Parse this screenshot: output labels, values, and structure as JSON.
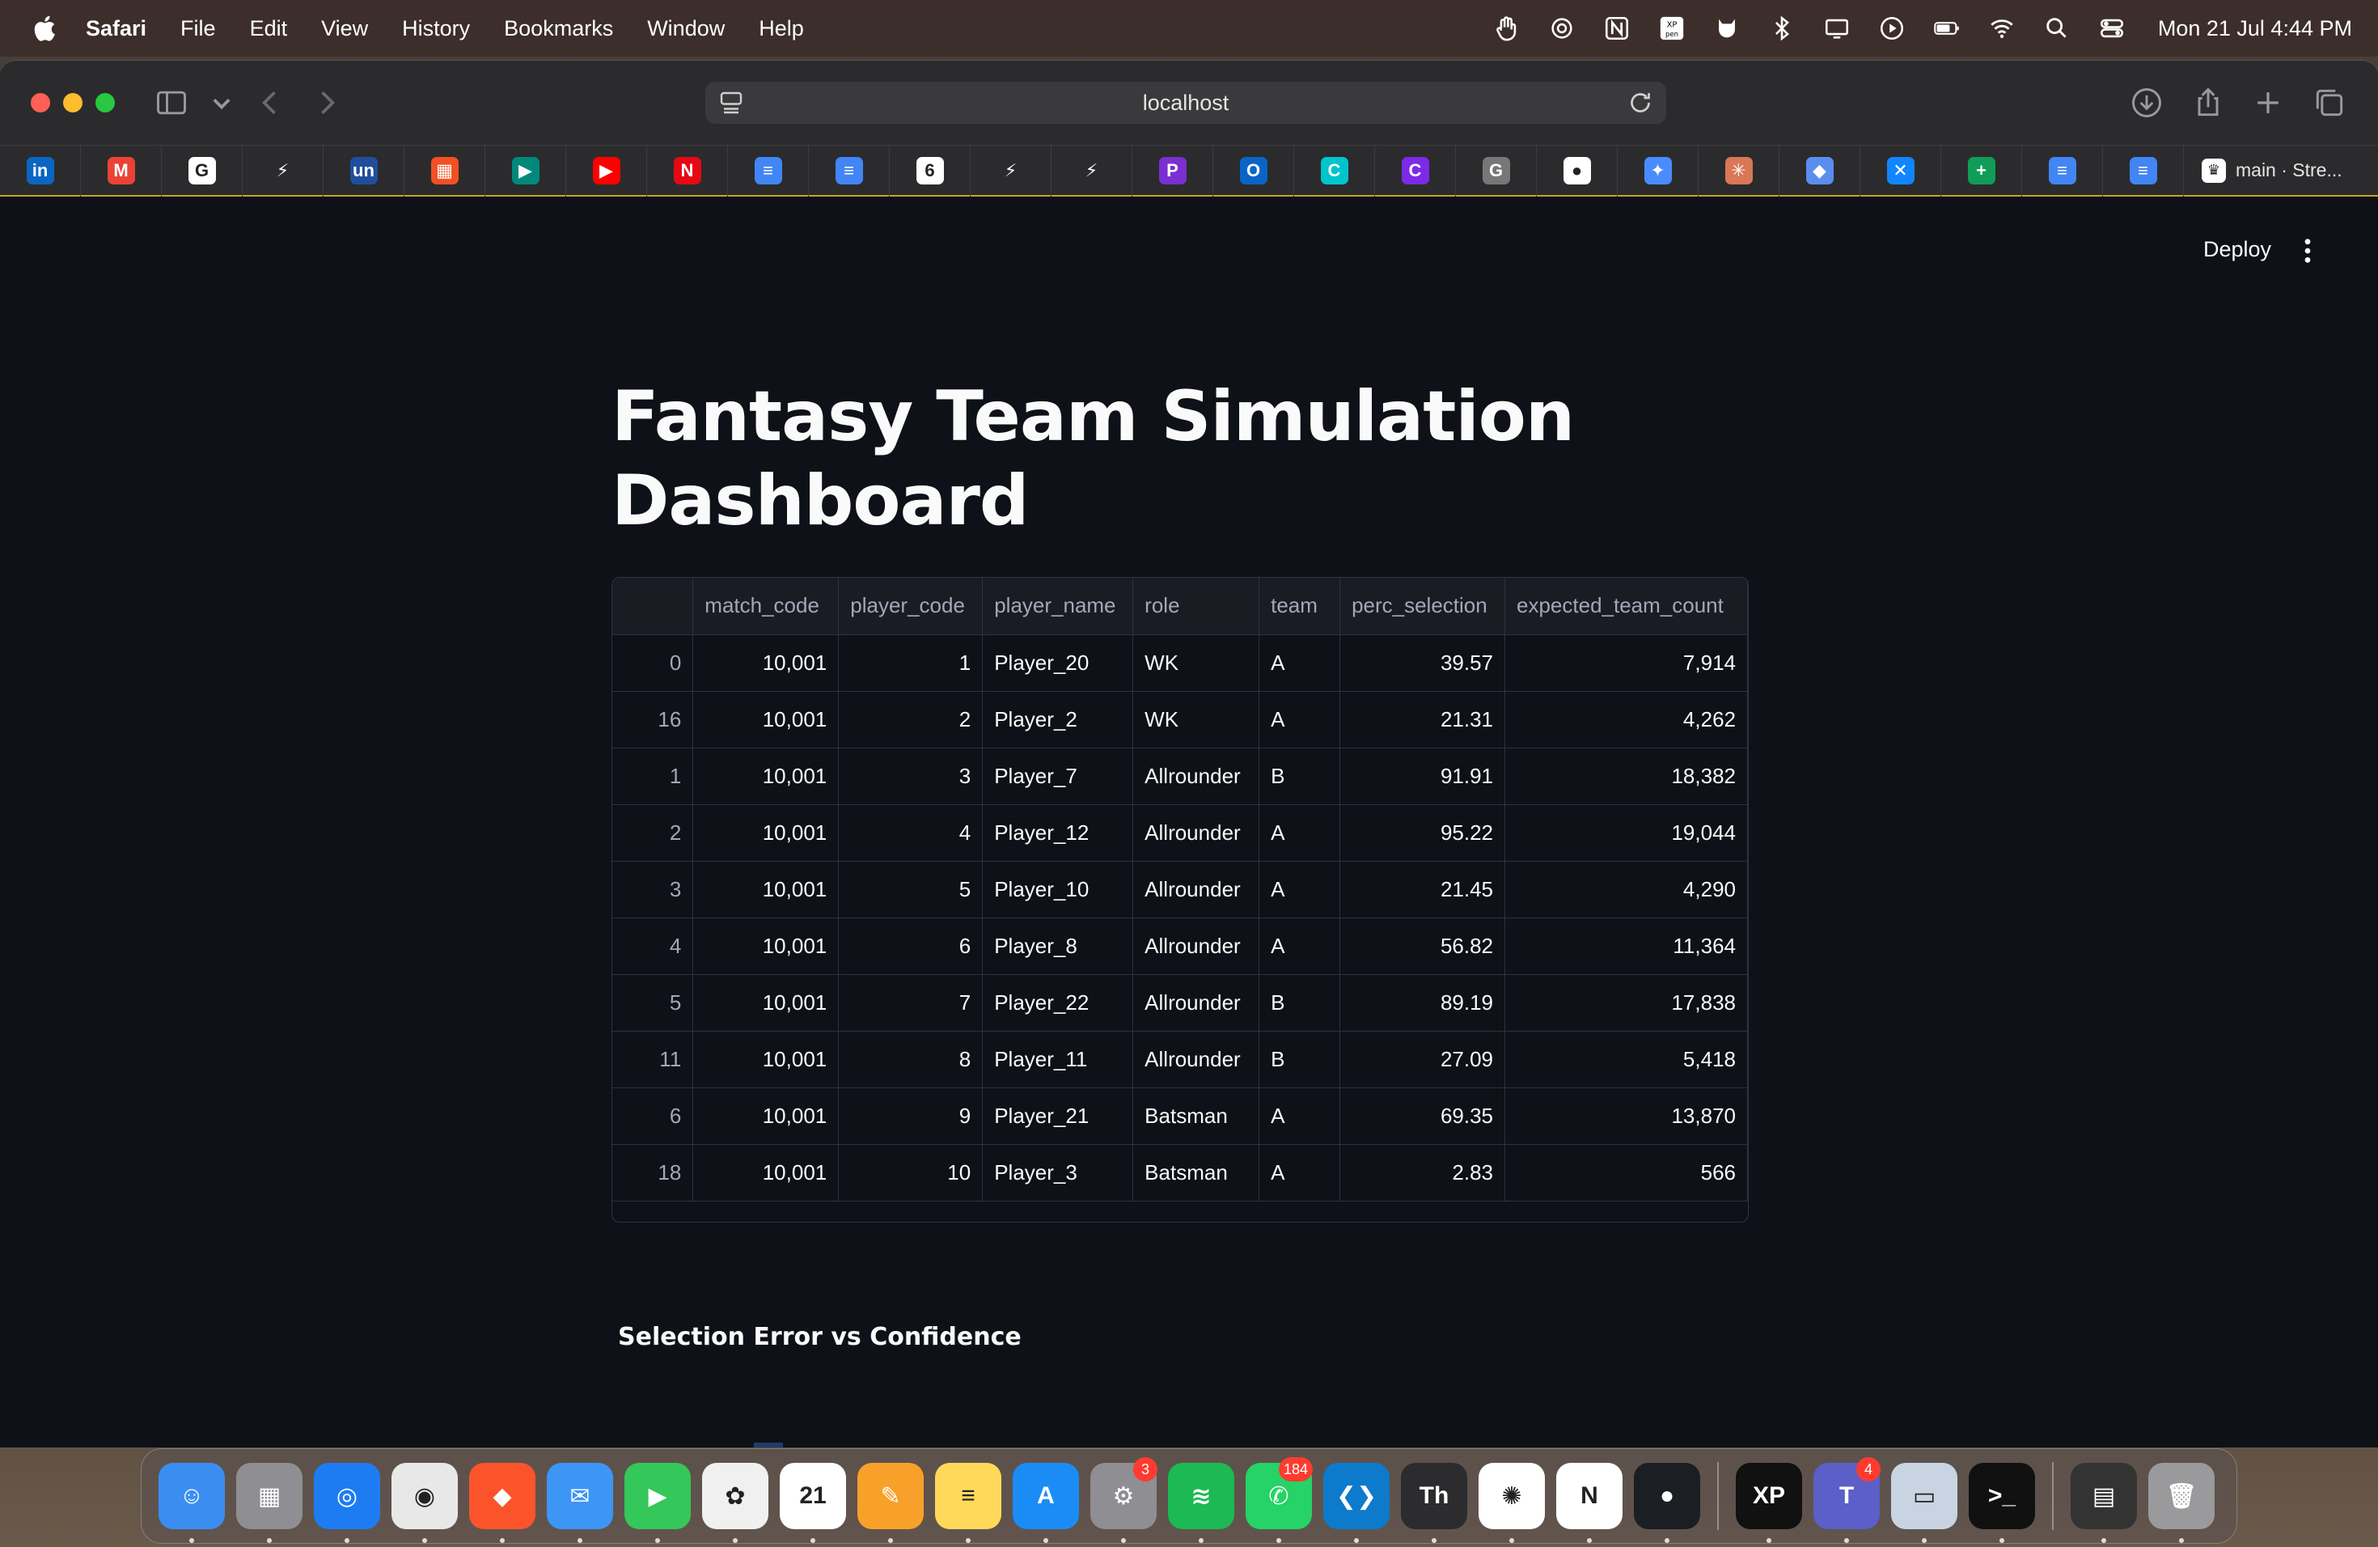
{
  "menubar": {
    "app_name": "Safari",
    "items": [
      "File",
      "Edit",
      "View",
      "History",
      "Bookmarks",
      "Window",
      "Help"
    ],
    "clock": "Mon 21 Jul  4:44 PM"
  },
  "browser": {
    "url": "localhost",
    "active_tab_label": "main · Stre...",
    "favorites": [
      {
        "icon": "linkedin-icon",
        "glyph": "in",
        "color": "#0a66c2"
      },
      {
        "icon": "gmail-icon",
        "glyph": "M",
        "color": "#ea4335"
      },
      {
        "icon": "google-icon",
        "glyph": "G",
        "color": "#ffffff"
      },
      {
        "icon": "bolt-icon",
        "glyph": "⚡",
        "color": "#2b2b2d"
      },
      {
        "icon": "unstop-icon",
        "glyph": "un",
        "color": "#1f4e9c"
      },
      {
        "icon": "microsoft-icon",
        "glyph": "▦",
        "color": "#f25022"
      },
      {
        "icon": "meet-icon",
        "glyph": "▶",
        "color": "#00897b"
      },
      {
        "icon": "youtube-icon",
        "glyph": "▶",
        "color": "#ff0000"
      },
      {
        "icon": "netflix-icon",
        "glyph": "N",
        "color": "#e50914"
      },
      {
        "icon": "docs-icon",
        "glyph": "≡",
        "color": "#4285f4"
      },
      {
        "icon": "docs-icon-2",
        "glyph": "≡",
        "color": "#4285f4"
      },
      {
        "icon": "loop-icon",
        "glyph": "6",
        "color": "#ffffff"
      },
      {
        "icon": "bolt-icon-2",
        "glyph": "⚡",
        "color": "#2b2b2d"
      },
      {
        "icon": "bolt-icon-3",
        "glyph": "⚡",
        "color": "#2b2b2d"
      },
      {
        "icon": "pixel-icon",
        "glyph": "P",
        "color": "#7b2fd1"
      },
      {
        "icon": "outlook-icon",
        "glyph": "O",
        "color": "#0a64c8"
      },
      {
        "icon": "canva-icon",
        "glyph": "C",
        "color": "#00c4cc"
      },
      {
        "icon": "canva-icon-2",
        "glyph": "C",
        "color": "#7d2ae8"
      },
      {
        "icon": "grammarly-icon",
        "glyph": "G",
        "color": "#777777"
      },
      {
        "icon": "github-icon",
        "glyph": "●",
        "color": "#ffffff"
      },
      {
        "icon": "gemini-icon",
        "glyph": "✦",
        "color": "#4a8cff"
      },
      {
        "icon": "claude-icon",
        "glyph": "✳",
        "color": "#d97757"
      },
      {
        "icon": "copilot-icon",
        "glyph": "◆",
        "color": "#5b8def"
      },
      {
        "icon": "bluesky-icon",
        "glyph": "✕",
        "color": "#1185fe"
      },
      {
        "icon": "sheets-icon",
        "glyph": "+",
        "color": "#0f9d58"
      },
      {
        "icon": "docs-icon-3",
        "glyph": "≡",
        "color": "#4285f4"
      },
      {
        "icon": "docs-icon-4",
        "glyph": "≡",
        "color": "#4285f4"
      }
    ]
  },
  "app": {
    "deploy_label": "Deploy",
    "title_line1": "Fantasy Team Simulation",
    "title_line2": "Dashboard",
    "section_title": "Selection Error vs Confidence"
  },
  "table": {
    "columns": [
      "",
      "match_code",
      "player_code",
      "player_name",
      "role",
      "team",
      "perc_selection",
      "expected_team_count"
    ],
    "rows": [
      [
        "0",
        "10,001",
        "1",
        "Player_20",
        "WK",
        "A",
        "39.57",
        "7,914"
      ],
      [
        "16",
        "10,001",
        "2",
        "Player_2",
        "WK",
        "A",
        "21.31",
        "4,262"
      ],
      [
        "1",
        "10,001",
        "3",
        "Player_7",
        "Allrounder",
        "B",
        "91.91",
        "18,382"
      ],
      [
        "2",
        "10,001",
        "4",
        "Player_12",
        "Allrounder",
        "A",
        "95.22",
        "19,044"
      ],
      [
        "3",
        "10,001",
        "5",
        "Player_10",
        "Allrounder",
        "A",
        "21.45",
        "4,290"
      ],
      [
        "4",
        "10,001",
        "6",
        "Player_8",
        "Allrounder",
        "A",
        "56.82",
        "11,364"
      ],
      [
        "5",
        "10,001",
        "7",
        "Player_22",
        "Allrounder",
        "B",
        "89.19",
        "17,838"
      ],
      [
        "11",
        "10,001",
        "8",
        "Player_11",
        "Allrounder",
        "B",
        "27.09",
        "5,418"
      ],
      [
        "6",
        "10,001",
        "9",
        "Player_21",
        "Batsman",
        "A",
        "69.35",
        "13,870"
      ],
      [
        "18",
        "10,001",
        "10",
        "Player_3",
        "Batsman",
        "A",
        "2.83",
        "566"
      ]
    ]
  },
  "dock": {
    "apps": [
      {
        "name": "finder-icon",
        "glyph": "☺",
        "color": "#3b8ef0"
      },
      {
        "name": "launchpad-icon",
        "glyph": "▦",
        "color": "#8e8e93"
      },
      {
        "name": "safari-icon",
        "glyph": "◎",
        "color": "#1e7cf2"
      },
      {
        "name": "chrome-icon",
        "glyph": "◉",
        "color": "#e8e8e8"
      },
      {
        "name": "brave-icon",
        "glyph": "◆",
        "color": "#fb542b"
      },
      {
        "name": "mail-icon",
        "glyph": "✉",
        "color": "#3d95f5"
      },
      {
        "name": "facetime-icon",
        "glyph": "▶",
        "color": "#34c759"
      },
      {
        "name": "photos-icon",
        "glyph": "✿",
        "color": "#f0f0f0"
      },
      {
        "name": "calendar-icon",
        "glyph": "21",
        "color": "#ffffff"
      },
      {
        "name": "pages-icon",
        "glyph": "✎",
        "color": "#f7a12a"
      },
      {
        "name": "notes-icon",
        "glyph": "≡",
        "color": "#ffd95a"
      },
      {
        "name": "appstore-icon",
        "glyph": "A",
        "color": "#1b8cf5"
      },
      {
        "name": "system-settings-icon",
        "glyph": "⚙",
        "color": "#8e8e93",
        "badge": "3"
      },
      {
        "name": "spotify-icon",
        "glyph": "≋",
        "color": "#1db954"
      },
      {
        "name": "whatsapp-icon",
        "glyph": "✆",
        "color": "#25d366",
        "badge": "184"
      },
      {
        "name": "vscode-icon",
        "glyph": "❮❯",
        "color": "#0e7acc"
      },
      {
        "name": "typora-icon",
        "glyph": "Th",
        "color": "#2c2c2e"
      },
      {
        "name": "chatgpt-icon",
        "glyph": "✺",
        "color": "#ffffff"
      },
      {
        "name": "notion-icon",
        "glyph": "N",
        "color": "#ffffff"
      },
      {
        "name": "github-desktop-icon",
        "glyph": "●",
        "color": "#1b1f23"
      },
      {
        "name": "xppen-icon",
        "glyph": "XP",
        "color": "#111111"
      },
      {
        "name": "teams-icon",
        "glyph": "T",
        "color": "#5b5fc7",
        "badge": "4"
      },
      {
        "name": "preview-icon",
        "glyph": "▭",
        "color": "#c9d4e2"
      },
      {
        "name": "terminal-icon",
        "glyph": ">_",
        "color": "#111111"
      },
      {
        "name": "archive-icon",
        "glyph": "▤",
        "color": "#333333"
      },
      {
        "name": "trash-icon",
        "glyph": "🗑",
        "color": "#9a9a9c"
      }
    ]
  }
}
